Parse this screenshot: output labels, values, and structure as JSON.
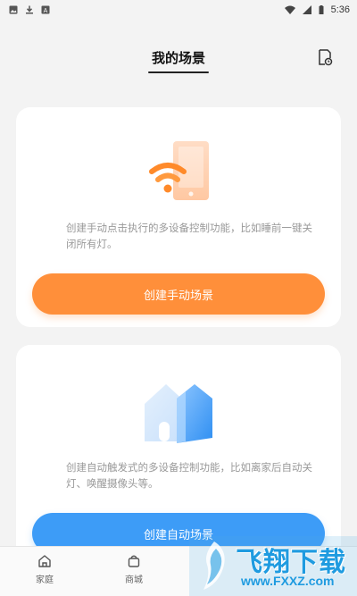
{
  "status_bar": {
    "time": "5:36"
  },
  "header": {
    "title": "我的场景",
    "action_icon": "scene-log-icon"
  },
  "cards": {
    "manual": {
      "illustration": "wifi-phone-illustration",
      "description": "创建手动点击执行的多设备控制功能，比如睡前一键关闭所有灯。",
      "button_label": "创建手动场景",
      "accent": "#ff8f3a"
    },
    "auto": {
      "illustration": "house-illustration",
      "description": "创建自动触发式的多设备控制功能，比如离家后自动关灯、唤醒摄像头等。",
      "button_label": "创建自动场景",
      "accent": "#3d9cf7"
    }
  },
  "nav": {
    "home_label": "家庭",
    "mall_label": "商城"
  },
  "watermark": {
    "main": "飞翔下载",
    "sub": "www.FXXZ.com"
  }
}
